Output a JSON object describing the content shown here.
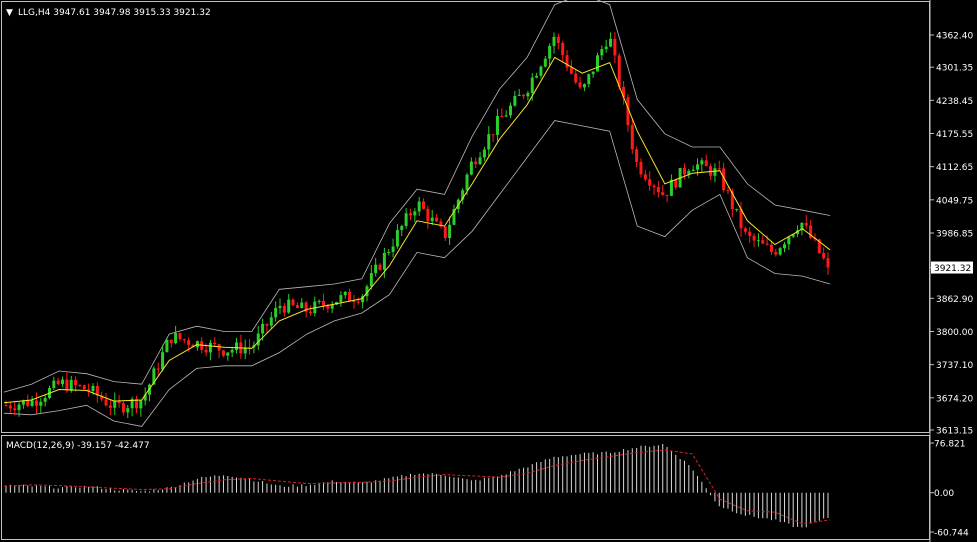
{
  "header": {
    "menu_glyph": "▼",
    "symbol_line": "LLG,H4  3947.61 3947.98 3915.33 3921.32"
  },
  "macd_header": {
    "label": "MACD(12,26,9) -39.157 -42.477"
  },
  "colors": {
    "background": "#000000",
    "frame": "#c0c0c0",
    "bull": "#2bcf2b",
    "bear": "#ff1a1a",
    "ma_yellow": "#f2e629",
    "bands": "#b8b8b8",
    "macd_hist": "#d8d8d8",
    "macd_signal": "#e02020",
    "price_tag_bg": "#ffffff",
    "price_tag_text": "#000000"
  },
  "chart_data": [
    {
      "type": "candlestick",
      "symbol": "LLG",
      "timeframe": "H4",
      "last_bar": {
        "open": 3947.61,
        "high": 3947.98,
        "low": 3915.33,
        "close": 3921.32
      },
      "current_price_label": "3921.32",
      "ylim": [
        3613.15,
        4400
      ],
      "y_ticks": [
        "4362.40",
        "4301.35",
        "4238.45",
        "4175.55",
        "4112.65",
        "4049.75",
        "3986.85",
        "3921.32",
        "3862.90",
        "3800.00",
        "3737.10",
        "3674.20",
        "3613.15"
      ],
      "y_tick_values": [
        4362.4,
        4301.35,
        4238.45,
        4175.55,
        4112.65,
        4049.75,
        3986.85,
        3921.32,
        3862.9,
        3800.0,
        3737.1,
        3674.2,
        3613.15
      ],
      "price_path": [
        [
          0,
          3660
        ],
        [
          10,
          3668
        ],
        [
          20,
          3702
        ],
        [
          30,
          3690
        ],
        [
          40,
          3655
        ],
        [
          50,
          3672
        ],
        [
          60,
          3790
        ],
        [
          70,
          3778
        ],
        [
          80,
          3765
        ],
        [
          90,
          3772
        ],
        [
          100,
          3850
        ],
        [
          110,
          3840
        ],
        [
          120,
          3860
        ],
        [
          130,
          3870
        ],
        [
          140,
          3960
        ],
        [
          150,
          4045
        ],
        [
          160,
          3980
        ],
        [
          170,
          4120
        ],
        [
          180,
          4200
        ],
        [
          190,
          4260
        ],
        [
          200,
          4360
        ],
        [
          210,
          4250
        ],
        [
          220,
          4365
        ],
        [
          230,
          4120
        ],
        [
          240,
          4060
        ],
        [
          250,
          4120
        ],
        [
          260,
          4100
        ],
        [
          270,
          3980
        ],
        [
          280,
          3950
        ],
        [
          290,
          4010
        ],
        [
          300,
          3921
        ]
      ],
      "series": [
        {
          "name": "",
          "role": "moving_average",
          "values": [
            3665,
            3670,
            3690,
            3688,
            3668,
            3670,
            3745,
            3775,
            3770,
            3768,
            3820,
            3842,
            3852,
            3862,
            3925,
            4010,
            4000,
            4080,
            4165,
            4230,
            4320,
            4290,
            4310,
            4180,
            4080,
            4100,
            4105,
            4010,
            3965,
            3995,
            3955
          ]
        },
        {
          "name": "",
          "role": "bollinger_upper",
          "values": [
            3685,
            3700,
            3725,
            3720,
            3705,
            3700,
            3795,
            3810,
            3800,
            3800,
            3880,
            3885,
            3890,
            3900,
            4005,
            4070,
            4060,
            4170,
            4260,
            4320,
            4420,
            4440,
            4420,
            4240,
            4175,
            4150,
            4150,
            4080,
            4040,
            4030,
            4020
          ]
        },
        {
          "name": "",
          "role": "bollinger_lower",
          "values": [
            3645,
            3642,
            3650,
            3660,
            3630,
            3620,
            3690,
            3730,
            3735,
            3735,
            3760,
            3795,
            3820,
            3835,
            3870,
            3950,
            3940,
            3990,
            4060,
            4130,
            4200,
            4190,
            4180,
            4000,
            3980,
            4030,
            4060,
            3940,
            3910,
            3905,
            3890
          ]
        }
      ]
    },
    {
      "type": "bar",
      "indicator": "MACD(12,26,9)",
      "main": -39.157,
      "signal": -42.477,
      "ylim": [
        -60.744,
        76.821
      ],
      "y_ticks": [
        "76.821",
        "0.00",
        "-60.744"
      ],
      "y_tick_values": [
        76.821,
        0,
        -60.744
      ],
      "histogram": [
        12,
        10,
        8,
        10,
        5,
        2,
        8,
        22,
        28,
        20,
        10,
        12,
        18,
        15,
        22,
        30,
        28,
        18,
        26,
        40,
        55,
        60,
        62,
        70,
        75,
        40,
        -20,
        -35,
        -42,
        -55,
        -39
      ],
      "signal_line": [
        10,
        12,
        11,
        9,
        7,
        5,
        6,
        14,
        20,
        22,
        18,
        14,
        15,
        16,
        18,
        24,
        28,
        26,
        24,
        30,
        42,
        50,
        56,
        62,
        66,
        60,
        -10,
        -28,
        -30,
        -48,
        -42
      ]
    }
  ]
}
